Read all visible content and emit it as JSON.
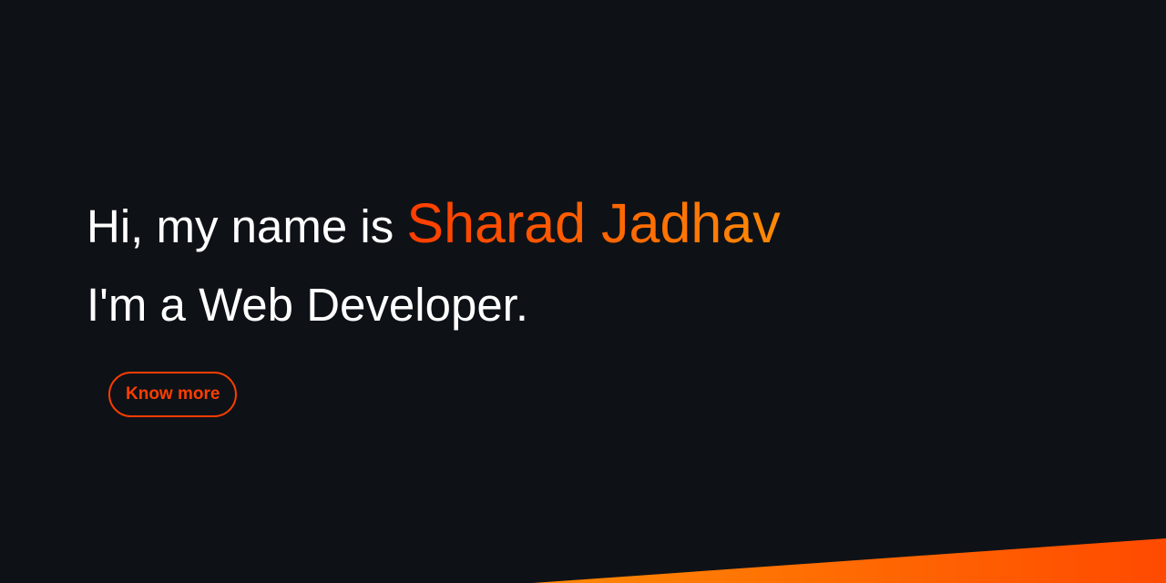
{
  "hero": {
    "greeting": "Hi, my name is ",
    "name": "Sharad Jadhav",
    "tagline": "I'm a Web Developer.",
    "cta_label": "Know more"
  },
  "colors": {
    "background": "#0e1217",
    "accent_start": "#ff3d00",
    "accent_end": "#ff8a05",
    "text": "#ffffff"
  }
}
